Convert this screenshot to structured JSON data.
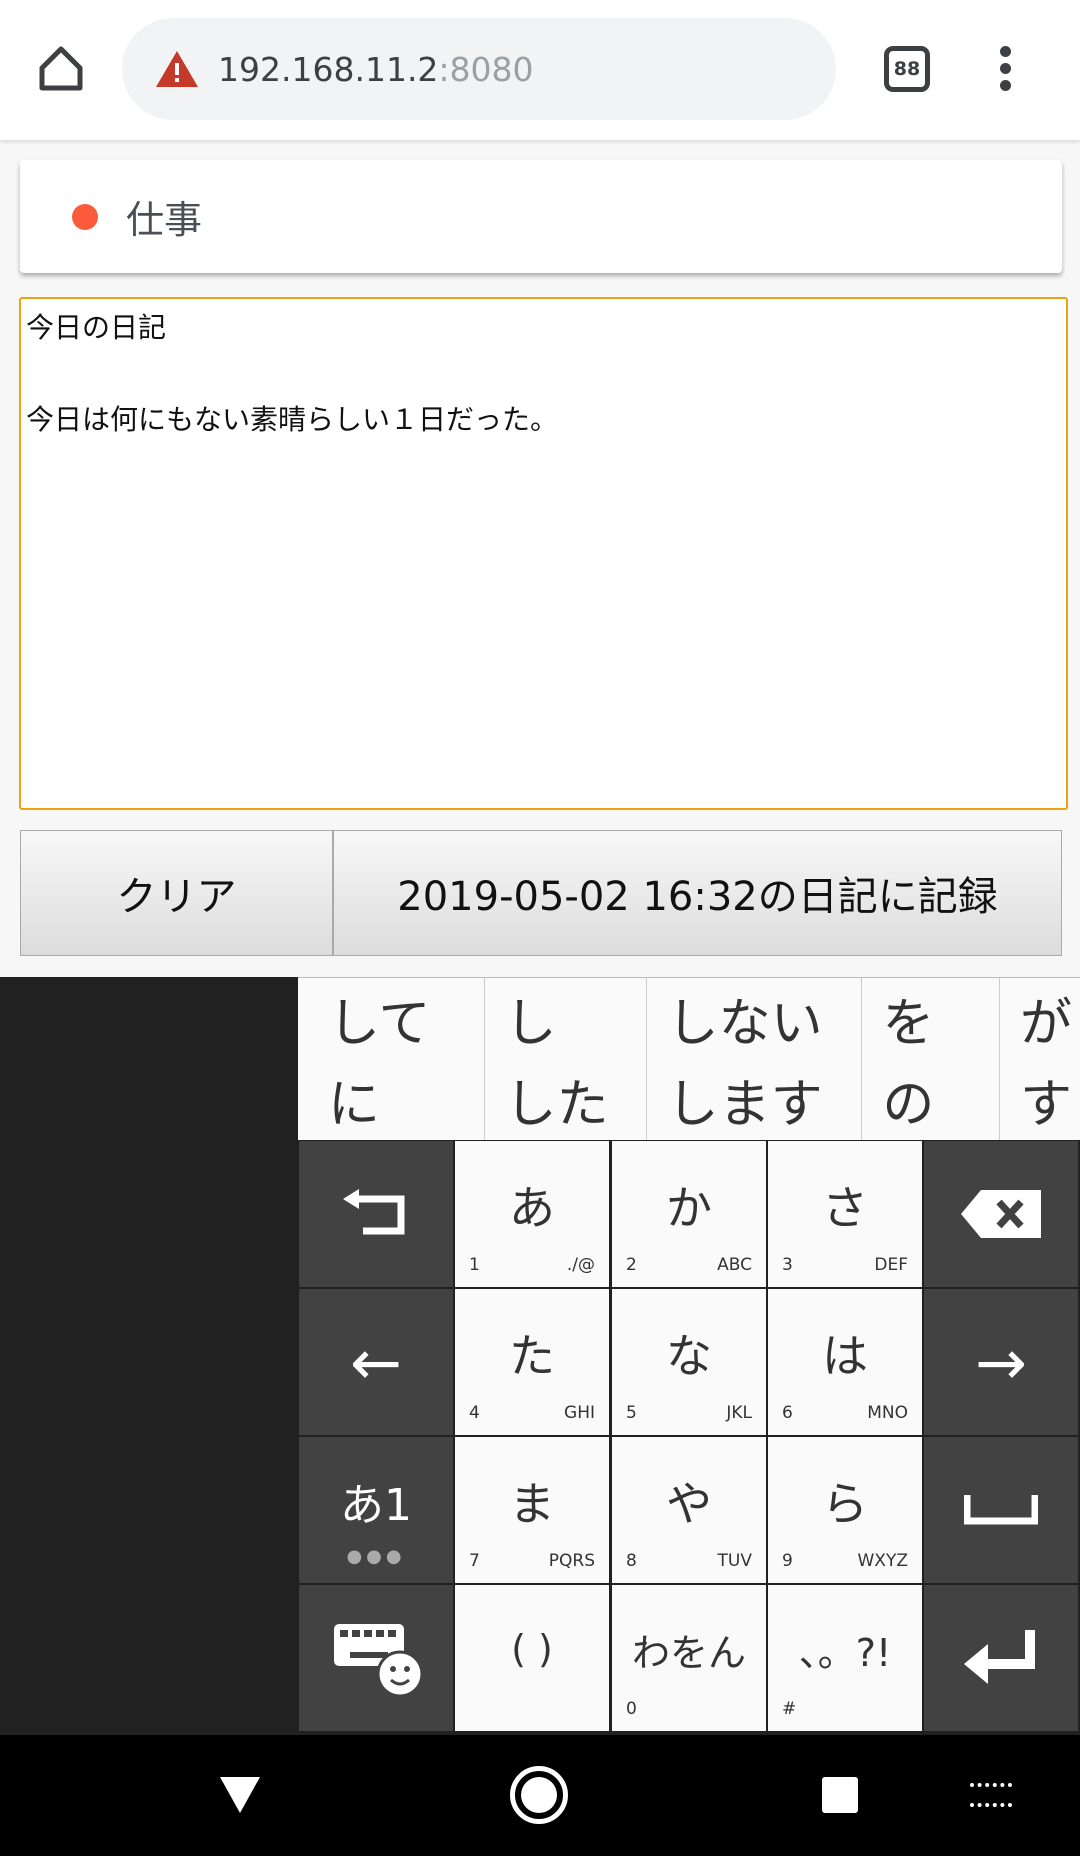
{
  "browser": {
    "url_host": "192.168.11.2",
    "url_port": ":8080",
    "tab_count": "88"
  },
  "category": {
    "label": "仕事",
    "color": "#fc5a3c"
  },
  "diary": {
    "text": "今日の日記\n\n今日は何にもない素晴らしい１日だった。"
  },
  "buttons": {
    "clear": "クリア",
    "record": "2019-05-02 16:32の日記に記録"
  },
  "keyboard": {
    "suggestions": [
      [
        "して",
        "に"
      ],
      [
        "し",
        "した"
      ],
      [
        "しない",
        "します"
      ],
      [
        "を",
        "の"
      ],
      [
        "が",
        "す"
      ]
    ],
    "keys": [
      {
        "main": "あ",
        "num": "1",
        "sub": "./@"
      },
      {
        "main": "か",
        "num": "2",
        "sub": "ABC"
      },
      {
        "main": "さ",
        "num": "3",
        "sub": "DEF"
      },
      {
        "main": "た",
        "num": "4",
        "sub": "GHI"
      },
      {
        "main": "な",
        "num": "5",
        "sub": "JKL"
      },
      {
        "main": "は",
        "num": "6",
        "sub": "MNO"
      },
      {
        "main": "ま",
        "num": "7",
        "sub": "PQRS"
      },
      {
        "main": "や",
        "num": "8",
        "sub": "TUV"
      },
      {
        "main": "ら",
        "num": "9",
        "sub": "WXYZ"
      },
      {
        "main": "( )",
        "num": "",
        "sub": ""
      },
      {
        "main": "わをん",
        "num": "0",
        "sub": ""
      },
      {
        "main": "、。?!",
        "num": "#",
        "sub": ""
      }
    ],
    "mode_label": "あ1"
  }
}
